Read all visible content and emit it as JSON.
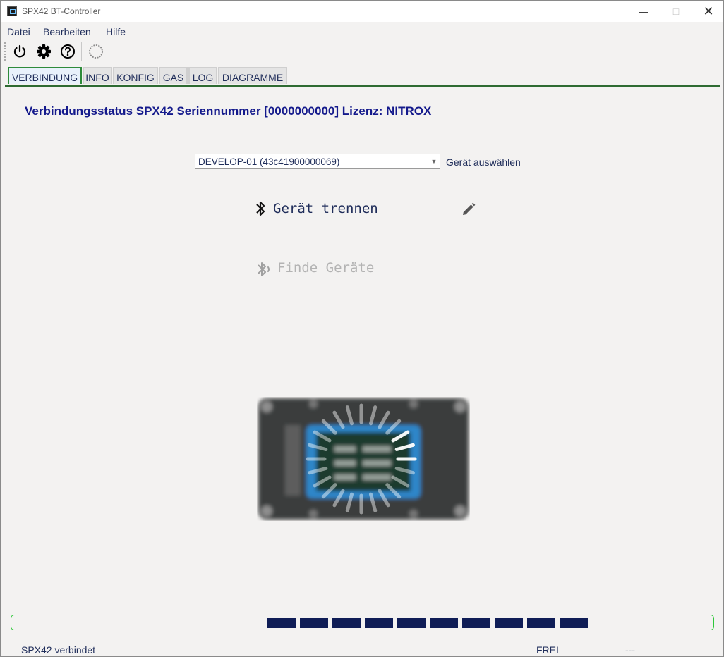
{
  "window": {
    "title": "SPX42 BT-Controller"
  },
  "menu": {
    "items": [
      "Datei",
      "Bearbeiten",
      "Hilfe"
    ]
  },
  "toolbar": {
    "icons": [
      "power-icon",
      "gear-icon",
      "help-icon",
      "spinner-icon"
    ]
  },
  "tabs": [
    "VERBINDUNG",
    "INFO",
    "KONFIG",
    "GAS",
    "LOG",
    "DIAGRAMME"
  ],
  "active_tab": "VERBINDUNG",
  "main": {
    "heading": "Verbindungsstatus SPX42 Seriennummer [0000000000] Lizenz: NITROX",
    "device_select": {
      "value": "DEVELOP-01 (43c41900000069)",
      "label": "Gerät auswählen"
    },
    "disconnect_label": "Gerät trennen",
    "find_label": "Finde Geräte"
  },
  "progress": {
    "filled_blocks": 10
  },
  "status": {
    "left": "SPX42 verbindet",
    "mid": "FREI",
    "right": "---"
  },
  "colors": {
    "heading": "#141a8c",
    "tab_active_border": "#2e8b3a",
    "progress_block": "#0f1d56",
    "progress_border": "#2ec83a"
  }
}
